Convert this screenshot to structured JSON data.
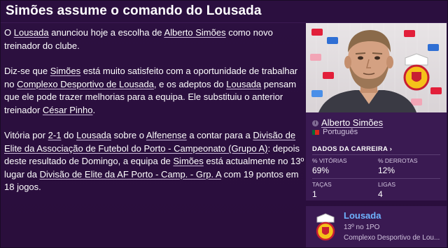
{
  "headline": "Simões assume o comando do Lousada",
  "article": {
    "p1": [
      {
        "t": "O "
      },
      {
        "t": "Lousada",
        "link": true
      },
      {
        "t": " anunciou hoje a escolha de "
      },
      {
        "t": "Alberto Simões",
        "link": true
      },
      {
        "t": " como novo treinador do clube."
      }
    ],
    "p2": [
      {
        "t": "Diz-se que "
      },
      {
        "t": "Simões",
        "link": true
      },
      {
        "t": " está muito satisfeito com a oportunidade de trabalhar no "
      },
      {
        "t": "Complexo Desportivo de Lousada",
        "link": true
      },
      {
        "t": ", e os adeptos do "
      },
      {
        "t": "Lousada",
        "link": true
      },
      {
        "t": " pensam que ele pode trazer melhorias para a equipa. Ele substituiu o anterior treinador "
      },
      {
        "t": "César Pinho",
        "link": true
      },
      {
        "t": "."
      }
    ],
    "p3": [
      {
        "t": "Vitória por "
      },
      {
        "t": "2-1",
        "link": true
      },
      {
        "t": " do "
      },
      {
        "t": "Lousada",
        "link": true
      },
      {
        "t": " sobre o "
      },
      {
        "t": "Alfenense",
        "link": true
      },
      {
        "t": " a contar para a "
      },
      {
        "t": "Divisão de Elite da Associação de Futebol do Porto - Campeonato (Grupo A)",
        "link": true
      },
      {
        "t": ": depois deste resultado de Domingo, a equipa de "
      },
      {
        "t": "Simões",
        "link": true
      },
      {
        "t": " está actualmente no 13º lugar da "
      },
      {
        "t": "Divisão de Elite da AF Porto - Camp. - Grp. A",
        "link": true
      },
      {
        "t": " com 19 pontos em 18 jogos."
      }
    ]
  },
  "manager": {
    "name": "Alberto Simões",
    "nation": "Português",
    "career_label": "DADOS DA CARREIRA",
    "career_chevron": "›",
    "stats": [
      {
        "label": "% VITÓRIAS",
        "value": "69%"
      },
      {
        "label": "% DERROTAS",
        "value": "12%"
      },
      {
        "label": "TAÇAS",
        "value": "1"
      },
      {
        "label": "LIGAS",
        "value": "4"
      }
    ]
  },
  "club": {
    "name": "Lousada",
    "position": "13º no 1PO",
    "stadium": "Complexo Desportivo de Lou..."
  },
  "colors": {
    "background": "#2a0f3d",
    "card": "#3a1a52",
    "link_accent": "#6fb4ff"
  },
  "icons": [
    "info-icon",
    "portugal-flag-icon",
    "club-crest-icon",
    "manager-portrait"
  ]
}
